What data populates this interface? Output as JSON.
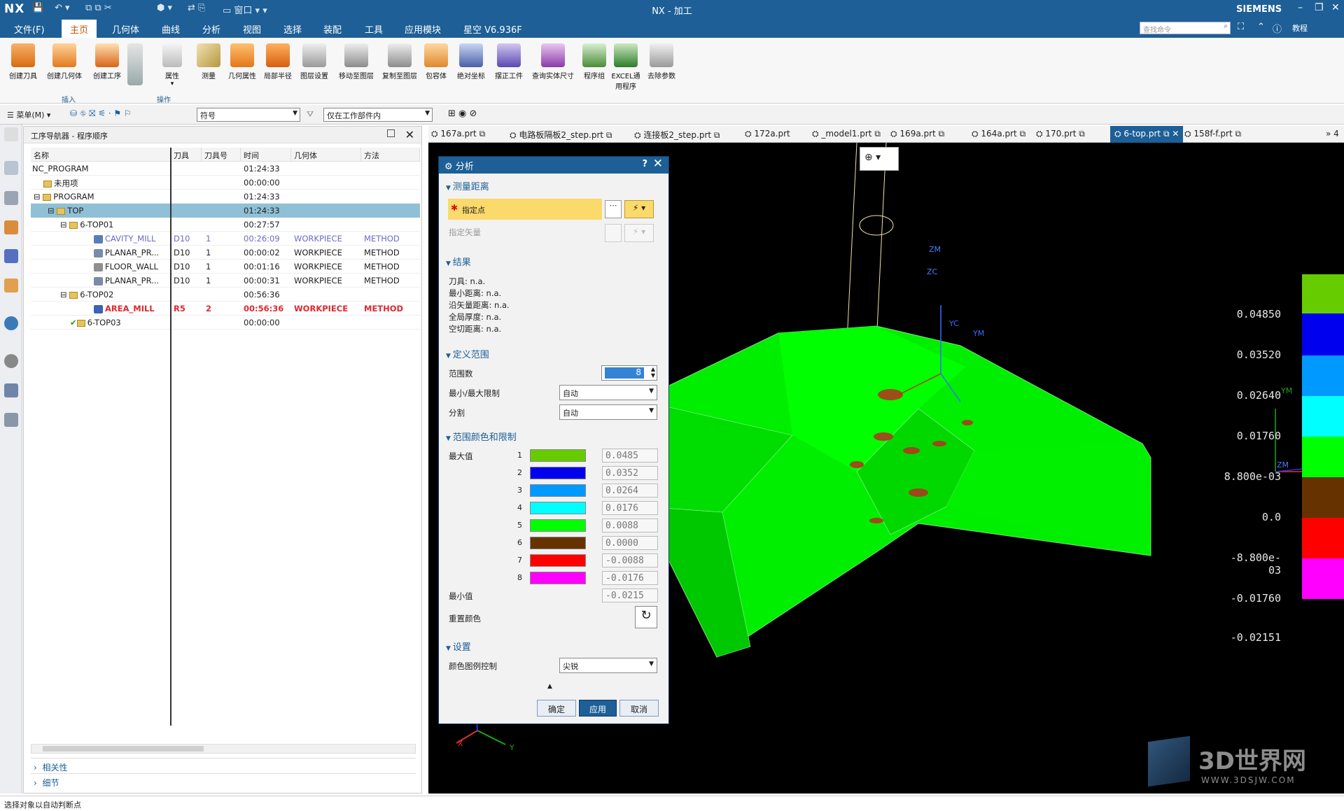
{
  "app": {
    "logo": "NX",
    "title": "NX - 加工",
    "brand": "SIEMENS"
  },
  "menu": {
    "items": [
      "文件(F)",
      "主页",
      "几何体",
      "曲线",
      "分析",
      "视图",
      "选择",
      "装配",
      "工具",
      "应用模块",
      "星空 V6.936F"
    ],
    "search_placeholder": "查找命令",
    "help_label": "教程"
  },
  "ribbon": {
    "buttons": [
      "创建刀具",
      "创建几何体",
      "创建工序",
      "属性",
      "测量",
      "几何属性",
      "局部半径",
      "图层设置",
      "移动至图层",
      "复制至图层",
      "包容体",
      "绝对坐标",
      "摆正工件",
      "查询实体尺寸",
      "程序组",
      "EXCEL通用程序",
      "去除参数"
    ],
    "groups": [
      "插入",
      "操作"
    ]
  },
  "toolbar2": {
    "menu_label": "菜单(M)",
    "filter_value": "符号",
    "scope_value": "仅在工作部件内"
  },
  "navigator": {
    "title": "工序导航器 - 程序顺序",
    "columns": [
      "名称",
      "刀具",
      "刀具号",
      "时间",
      "几何体",
      "方法"
    ],
    "rows": [
      {
        "name": "NC_PROGRAM",
        "tool": "",
        "num": "",
        "time": "01:24:33",
        "geom": "",
        "method": ""
      },
      {
        "name": "未用项",
        "tool": "",
        "num": "",
        "time": "00:00:00",
        "geom": "",
        "method": ""
      },
      {
        "name": "PROGRAM",
        "tool": "",
        "num": "",
        "time": "01:24:33",
        "geom": "",
        "method": ""
      },
      {
        "name": "TOP",
        "tool": "",
        "num": "",
        "time": "01:24:33",
        "geom": "",
        "method": ""
      },
      {
        "name": "6-TOP01",
        "tool": "",
        "num": "",
        "time": "00:27:57",
        "geom": "",
        "method": ""
      },
      {
        "name": "CAVITY_MILL",
        "tool": "D10",
        "num": "1",
        "time": "00:26:09",
        "geom": "WORKPIECE",
        "method": "METHOD"
      },
      {
        "name": "PLANAR_PR...",
        "tool": "D10",
        "num": "1",
        "time": "00:00:02",
        "geom": "WORKPIECE",
        "method": "METHOD"
      },
      {
        "name": "FLOOR_WALL",
        "tool": "D10",
        "num": "1",
        "time": "00:01:16",
        "geom": "WORKPIECE",
        "method": "METHOD"
      },
      {
        "name": "PLANAR_PR...",
        "tool": "D10",
        "num": "1",
        "time": "00:00:31",
        "geom": "WORKPIECE",
        "method": "METHOD"
      },
      {
        "name": "6-TOP02",
        "tool": "",
        "num": "",
        "time": "00:56:36",
        "geom": "",
        "method": ""
      },
      {
        "name": "AREA_MILL",
        "tool": "R5",
        "num": "2",
        "time": "00:56:36",
        "geom": "WORKPIECE",
        "method": "METHOD"
      },
      {
        "name": "6-TOP03",
        "tool": "",
        "num": "",
        "time": "00:00:00",
        "geom": "",
        "method": ""
      }
    ],
    "sections": [
      "相关性",
      "细节"
    ]
  },
  "tabs": [
    "167a.prt",
    "电路板隔板2_step.prt",
    "连接板2_step.prt",
    "172a.prt",
    "_model1.prt",
    "169a.prt",
    "164a.prt",
    "170.prt",
    "6-top.prt",
    "158f-f.prt"
  ],
  "tabs_overflow": "» 4",
  "dialog": {
    "title": "分析",
    "help": "?",
    "sections": {
      "measure": "测量距离",
      "result": "结果",
      "range": "定义范围",
      "colors": "范围颜色和限制",
      "settings": "设置"
    },
    "specify_point": "指定点",
    "specify_vector": "指定矢量",
    "results": [
      "刀具: n.a.",
      "最小距离: n.a.",
      "沿矢量距离: n.a.",
      "全局厚度: n.a.",
      "空切距离: n.a."
    ],
    "range_count_label": "范围数",
    "range_count": "8",
    "minmax_label": "最小/最大限制",
    "minmax_value": "自动",
    "split_label": "分割",
    "split_value": "自动",
    "max_label": "最大值",
    "min_label": "最小值",
    "reset_label": "重置颜色",
    "color_rows": [
      {
        "i": "1",
        "color": "#66cc00",
        "value": "0.0485"
      },
      {
        "i": "2",
        "color": "#0000ee",
        "value": "0.0352"
      },
      {
        "i": "3",
        "color": "#0099ff",
        "value": "0.0264"
      },
      {
        "i": "4",
        "color": "#00ffff",
        "value": "0.0176"
      },
      {
        "i": "5",
        "color": "#00ff00",
        "value": "0.0088"
      },
      {
        "i": "6",
        "color": "#663300",
        "value": "0.0000"
      },
      {
        "i": "7",
        "color": "#ff0000",
        "value": "-0.0088"
      },
      {
        "i": "8",
        "color": "#ff00ff",
        "value": "-0.0176"
      }
    ],
    "min_value": "-0.0215",
    "legend_ctrl_label": "颜色图例控制",
    "legend_ctrl_value": "尖锐",
    "ok": "确定",
    "apply": "应用",
    "cancel": "取消"
  },
  "legend": {
    "labels": [
      "0.04850",
      "0.03520",
      "0.02640",
      "0.01760",
      "8.800e-03",
      "0.0",
      "-8.800e-03",
      "-0.01760",
      "-0.02151"
    ],
    "colors": [
      "#66cc00",
      "#0000ee",
      "#0099ff",
      "#00ffff",
      "#00ff00",
      "#663300",
      "#ff0000",
      "#ff00ff"
    ]
  },
  "axes": {
    "zm": "ZM",
    "zc": "ZC",
    "yc": "YC",
    "ym": "YM",
    "ym2": "YM",
    "zm2": "ZM",
    "x": "X",
    "y": "Y",
    "xm": "X"
  },
  "watermark": {
    "main": "3D世界网",
    "url": "WWW.3DSJW.COM"
  },
  "status": "选择对象以自动判断点"
}
